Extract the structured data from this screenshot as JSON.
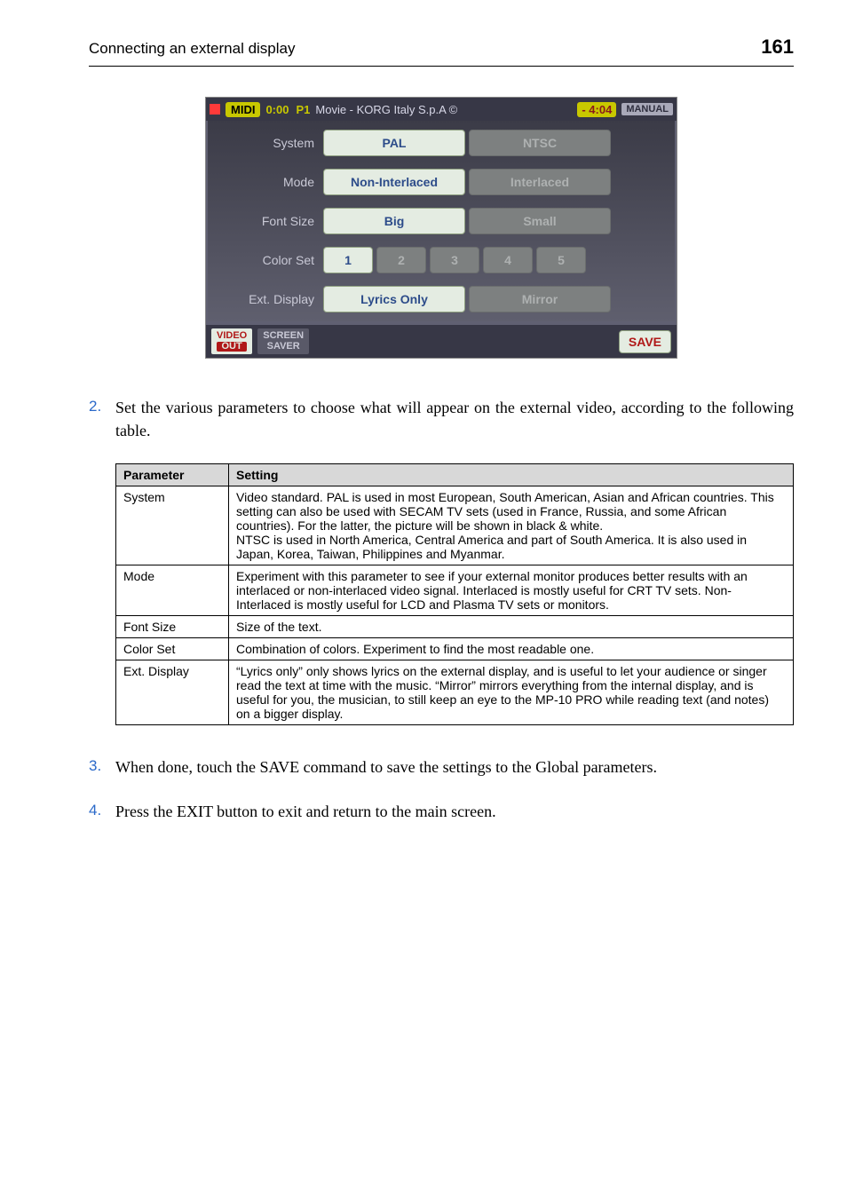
{
  "header": {
    "title": "Connecting an external display",
    "page_number": "161"
  },
  "ui": {
    "titlebar": {
      "midi_label": "MIDI",
      "time1": "0:00",
      "p1_label": "P1",
      "track_text": "Movie - KORG Italy S.p.A ©",
      "time2": "- 4:04",
      "manual": "MANUAL"
    },
    "rows": {
      "system": {
        "label": "System",
        "opt1": "PAL",
        "opt2": "NTSC"
      },
      "mode": {
        "label": "Mode",
        "opt1": "Non-Interlaced",
        "opt2": "Interlaced"
      },
      "font_size": {
        "label": "Font Size",
        "opt1": "Big",
        "opt2": "Small"
      },
      "color_set": {
        "label": "Color Set",
        "o1": "1",
        "o2": "2",
        "o3": "3",
        "o4": "4",
        "o5": "5"
      },
      "ext_display": {
        "label": "Ext. Display",
        "opt1": "Lyrics Only",
        "opt2": "Mirror"
      }
    },
    "footer": {
      "tab1_line1": "VIDEO",
      "tab1_line2": "OUT",
      "tab2_line1": "SCREEN",
      "tab2_line2": "SAVER",
      "save": "SAVE"
    }
  },
  "body": {
    "p2": "Set the various parameters to choose what will appear on the external video, according to the following table.",
    "p3": "When done, touch the SAVE command to save the settings to the Global parameters.",
    "p4": "Press the EXIT button to exit and return to the main screen."
  },
  "nums": {
    "n2": "2.",
    "n3": "3.",
    "n4": "4."
  },
  "table": {
    "head_param": "Parameter",
    "head_setting": "Setting",
    "rows": {
      "system": {
        "p": "System",
        "s": "Video standard. PAL is used in most European, South American, Asian and African countries. This setting can also be used with SECAM TV sets (used in France, Russia, and some African countries). For the latter, the picture will be shown in black & white.\nNTSC is used in North America, Central America and part of South America. It is also used in Japan, Korea, Taiwan, Philippines and Myanmar."
      },
      "mode": {
        "p": "Mode",
        "s": "Experiment with this parameter to see if your external monitor produces better results with an interlaced or non-interlaced video signal. Interlaced is mostly useful for CRT TV sets. Non-Interlaced is mostly useful for LCD and Plasma TV sets or monitors."
      },
      "font_size": {
        "p": "Font Size",
        "s": "Size of the text."
      },
      "color_set": {
        "p": "Color Set",
        "s": "Combination of colors. Experiment to find the most readable one."
      },
      "ext_display": {
        "p": "Ext. Display",
        "s": "“Lyrics only” only shows lyrics on the external display, and is useful to let your audience or singer read the text at time with the music. “Mirror” mirrors everything from the internal display, and is useful for you, the musician, to still keep an eye to the MP-10 PRO while reading text (and notes) on a bigger display."
      }
    }
  }
}
